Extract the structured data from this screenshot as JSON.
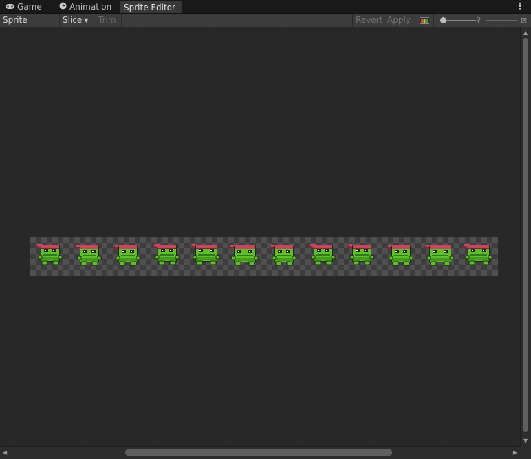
{
  "tabs": [
    {
      "label": "Game",
      "icon": "gamepad-icon",
      "active": false
    },
    {
      "label": "Animation",
      "icon": "clock-icon",
      "active": false
    },
    {
      "label": "Sprite Editor",
      "icon": "",
      "active": true
    }
  ],
  "tab_menu_glyph": "⋮",
  "toolbar": {
    "mode_label": "Sprite Editor",
    "slice_label": "Slice",
    "trim_label": "Trim",
    "revert_label": "Revert",
    "apply_label": "Apply",
    "channel_icon": "color-channel-icon",
    "zoom_icon": "magnifier-icon",
    "zoom_reset_icon": "reset-icon"
  },
  "sprite_sheet": {
    "frame_count": 12,
    "colors": {
      "skin": "#5fbf2a",
      "skin_dark": "#2f7a1a",
      "outline": "#1a2a12",
      "bandana": "#c8455e",
      "bandana_dark": "#8a2236",
      "eye": "#ffffff"
    }
  },
  "colors": {
    "canvas_bg": "#282828",
    "toolbar_bg": "#3c3c3c",
    "tabbar_bg": "#191919",
    "active_tab_bg": "#383838"
  }
}
